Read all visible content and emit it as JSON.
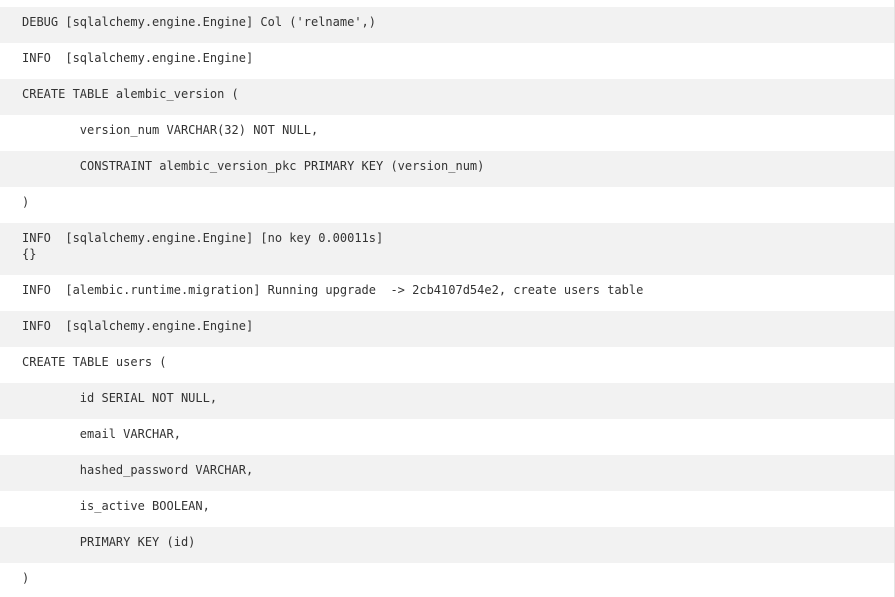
{
  "log": {
    "lines": [
      "DEBUG [sqlalchemy.engine.Engine] Col ('relname',)",
      "INFO  [sqlalchemy.engine.Engine]",
      "CREATE TABLE alembic_version (",
      "        version_num VARCHAR(32) NOT NULL,",
      "        CONSTRAINT alembic_version_pkc PRIMARY KEY (version_num)",
      ")",
      "INFO  [sqlalchemy.engine.Engine] [no key 0.00011s]\n{}",
      "INFO  [alembic.runtime.migration] Running upgrade  -> 2cb4107d54e2, create users table",
      "INFO  [sqlalchemy.engine.Engine]",
      "CREATE TABLE users (",
      "        id SERIAL NOT NULL,",
      "        email VARCHAR,",
      "        hashed_password VARCHAR,",
      "        is_active BOOLEAN,",
      "        PRIMARY KEY (id)",
      ")"
    ]
  }
}
